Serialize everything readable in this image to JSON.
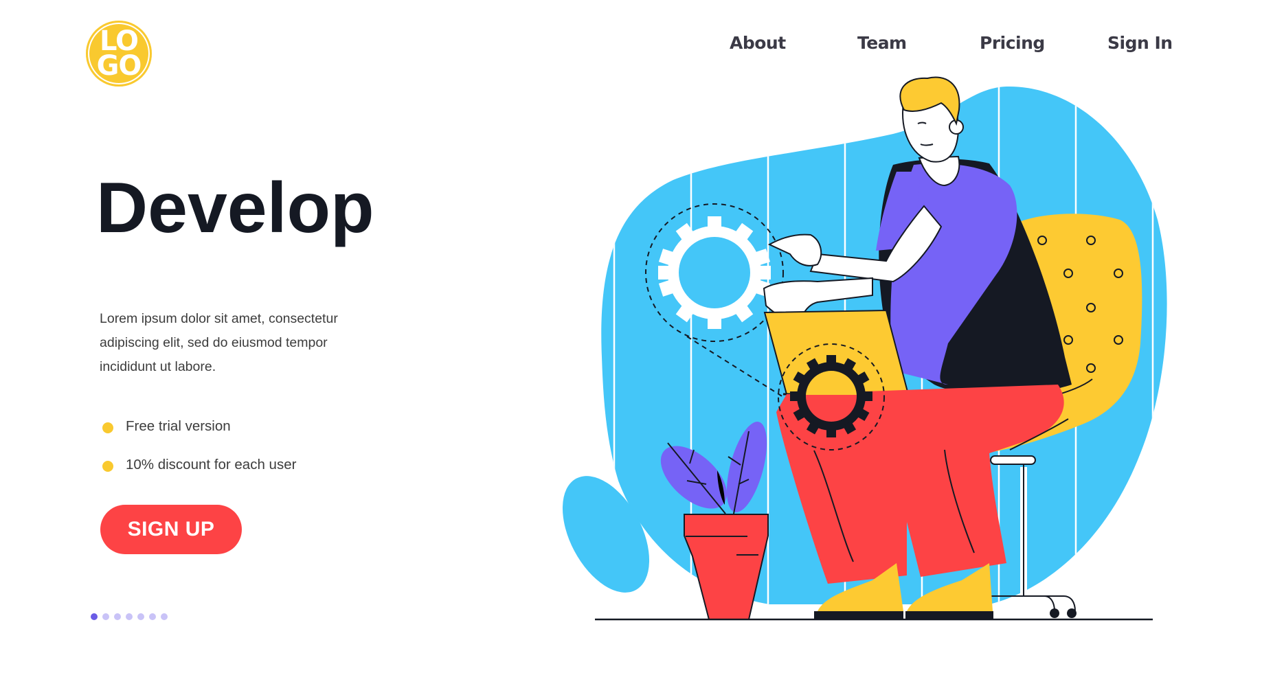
{
  "logo": {
    "line1": "LO",
    "line2": "GO",
    "color": "#f9c92f"
  },
  "nav": {
    "items": [
      {
        "label": "About"
      },
      {
        "label": "Team"
      },
      {
        "label": "Pricing"
      },
      {
        "label": "Sign In"
      }
    ]
  },
  "hero": {
    "title": "Develop",
    "description": "Lorem ipsum dolor sit amet, consectetur adipiscing elit, sed do eiusmod tempor incididunt ut labore.",
    "features": [
      {
        "label": "Free trial version",
        "icon": "yellow-bullet-dot"
      },
      {
        "label": "10% discount for each user",
        "icon": "yellow-bullet-dot"
      }
    ],
    "cta_label": "SIGN UP",
    "cta_color": "#fd4345"
  },
  "pagination": {
    "total": 7,
    "active_index": 0,
    "active_color": "#6a5ce6",
    "inactive_color": "#c9c3f7"
  },
  "illustration": {
    "subject": "developer sitting on chair with laptop and gears",
    "colors": {
      "background_blob": "#44c6f8",
      "shirt": "#7663f6",
      "vest": "#151923",
      "pants": "#fd4345",
      "chair": "#fdca32",
      "hair": "#fdca32",
      "shoes": "#fdca32",
      "pot": "#fd4345",
      "leaves": "#7663f6"
    }
  }
}
